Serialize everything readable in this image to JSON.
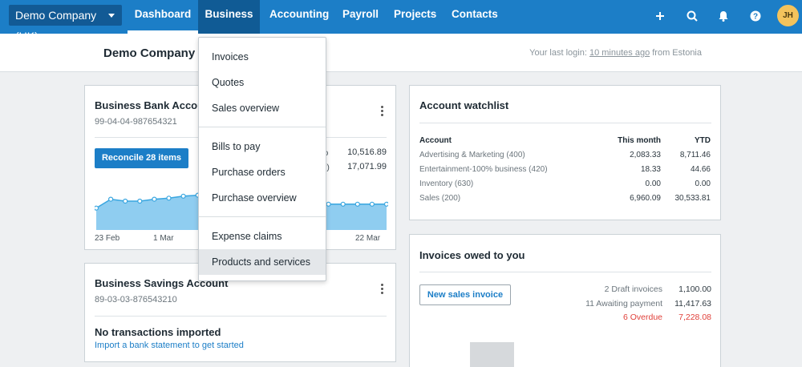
{
  "nav": {
    "org_switcher": "Demo Company (UK)",
    "items": [
      "Dashboard",
      "Business",
      "Accounting",
      "Payroll",
      "Projects",
      "Contacts"
    ],
    "icons": [
      "plus-icon",
      "search-icon",
      "bell-icon",
      "help-icon"
    ],
    "avatar_initials": "JH"
  },
  "subheader": {
    "org_title": "Demo Company (UK)",
    "last_login_prefix": "Your last login:",
    "last_login_time": "10 minutes ago",
    "last_login_suffix": "from Estonia"
  },
  "bank_card": {
    "title": "Business Bank Account",
    "account_number": "99-04-04-987654321",
    "reconcile_label": "Reconcile 28 items",
    "balance_rows": [
      {
        "label_tail": "ro",
        "value": "10,516.89"
      },
      {
        "label_tail": "ar)",
        "value": "17,071.99"
      }
    ],
    "axis_labels": [
      "23 Feb",
      "1 Mar",
      "22 Mar"
    ]
  },
  "chart_data": {
    "type": "area",
    "series": [
      {
        "values": [
          2.2,
          3.1,
          2.9,
          2.9,
          3.1,
          3.2,
          3.4,
          3.5,
          3.6,
          3.8,
          3.9,
          3.9,
          3.7,
          3.6,
          2.6,
          2.6,
          2.6,
          2.6,
          2.6,
          2.6,
          2.6
        ]
      }
    ],
    "x_ticks": [
      "23 Feb",
      "1 Mar",
      "22 Mar"
    ],
    "fill_color": "#8fcdf0",
    "line_color": "#39a6e0"
  },
  "savings_card": {
    "title": "Business Savings Account",
    "account_number": "89-03-03-876543210",
    "empty_title": "No transactions imported",
    "empty_link": "Import a bank statement to get started"
  },
  "watchlist": {
    "title": "Account watchlist",
    "headers": [
      "Account",
      "This month",
      "YTD"
    ],
    "rows": [
      {
        "name": "Advertising & Marketing (400)",
        "month": "2,083.33",
        "ytd": "8,711.46"
      },
      {
        "name": "Entertainment-100% business (420)",
        "month": "18.33",
        "ytd": "44.66"
      },
      {
        "name": "Inventory (630)",
        "month": "0.00",
        "ytd": "0.00"
      },
      {
        "name": "Sales (200)",
        "month": "6,960.09",
        "ytd": "30,533.81"
      }
    ]
  },
  "invoices": {
    "title": "Invoices owed to you",
    "new_button": "New sales invoice",
    "summary": [
      {
        "label": "2 Draft invoices",
        "value": "1,100.00"
      },
      {
        "label": "11 Awaiting payment",
        "value": "11,417.63"
      },
      {
        "label": "6 Overdue",
        "value": "7,228.08",
        "color": "#e0403a"
      }
    ]
  },
  "dropdown": {
    "groups": [
      [
        "Invoices",
        "Quotes",
        "Sales overview"
      ],
      [
        "Bills to pay",
        "Purchase orders",
        "Purchase overview"
      ],
      [
        "Expense claims",
        "Products and services"
      ]
    ],
    "highlighted": "Products and services"
  },
  "colors": {
    "nav_bg": "#1c7ec7",
    "nav_active_bg": "#105b95",
    "overdue": "#e0403a"
  }
}
